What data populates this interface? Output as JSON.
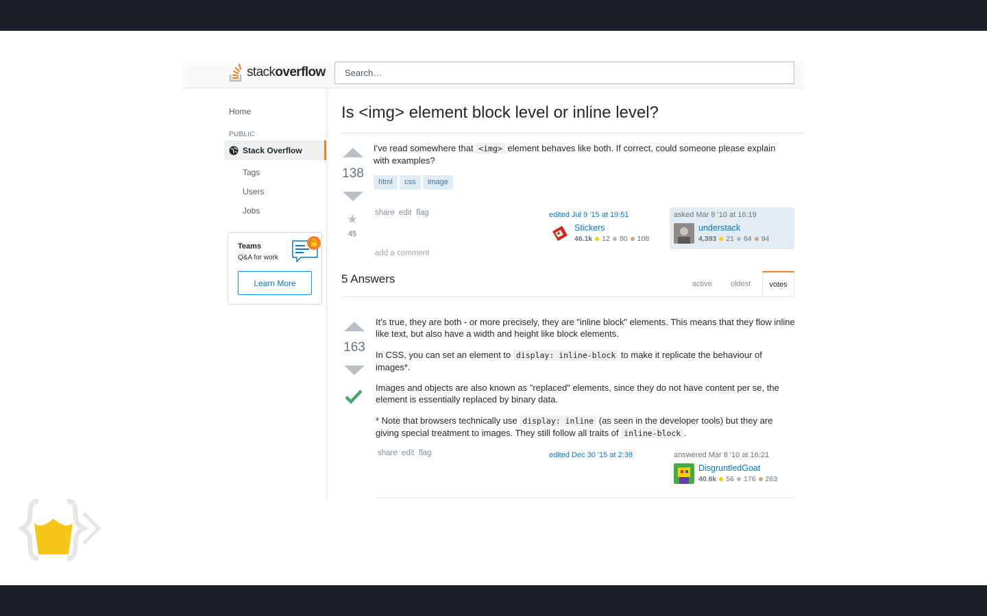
{
  "header": {
    "logo_light": "stack",
    "logo_bold": "overflow",
    "search_placeholder": "Search…"
  },
  "sidebar": {
    "home": "Home",
    "public_label": "PUBLIC",
    "active_item": "Stack Overflow",
    "items": [
      "Tags",
      "Users",
      "Jobs"
    ],
    "teams": {
      "title": "Teams",
      "subtitle": "Q&A for work",
      "button": "Learn More"
    }
  },
  "question": {
    "title": "Is <img> element block level or inline level?",
    "votes": "138",
    "favorites": "45",
    "body_before": "I've read somewhere that ",
    "body_code": "<img>",
    "body_after": " element behaves like both. If correct, could someone please explain with examples?",
    "tags": [
      "html",
      "css",
      "image"
    ],
    "menu": [
      "share",
      "edit",
      "flag"
    ],
    "edited": "edited Jul 9 '15 at 19:51",
    "editor": {
      "name": "Stickers",
      "rep": "46.1k",
      "gold": "12",
      "silver": "80",
      "bronze": "108"
    },
    "asked": "asked Mar 8 '10 at 16:19",
    "owner": {
      "name": "understack",
      "rep": "4,393",
      "gold": "21",
      "silver": "64",
      "bronze": "94"
    },
    "add_comment": "add a comment"
  },
  "answers": {
    "count_label": "5 Answers",
    "sort_tabs": [
      "active",
      "oldest",
      "votes"
    ],
    "active_sort": "votes"
  },
  "answer": {
    "votes": "163",
    "p1": "It's true, they are both - or more precisely, they are \"inline block\" elements. This means that they flow inline like text, but also have a width and height like block elements.",
    "p2_before": "In CSS, you can set an element to ",
    "p2_code": "display: inline-block",
    "p2_after": " to make it replicate the behaviour of images*.",
    "p3": "Images and objects are also known as \"replaced\" elements, since they do not have content per se, the element is essentially replaced by binary data.",
    "p4_before": "* Note that browsers technically use ",
    "p4_code1": "display: inline",
    "p4_mid": " (as seen in the developer tools) but they are giving special treatment to images. They still follow all traits of ",
    "p4_code2": "inline-block",
    "p4_after": ".",
    "menu": [
      "share",
      "edit",
      "flag"
    ],
    "edited": "edited Dec 30 '15 at 2:38",
    "answered": "answered Mar 8 '10 at 16:21",
    "author": {
      "name": "DisgruntledGoat",
      "rep": "40.6k",
      "gold": "56",
      "silver": "176",
      "bronze": "263"
    }
  },
  "colors": {
    "accent": "#f48024",
    "link": "#0077cc",
    "tag_bg": "#e1ecf4",
    "accepted": "#48a868"
  }
}
